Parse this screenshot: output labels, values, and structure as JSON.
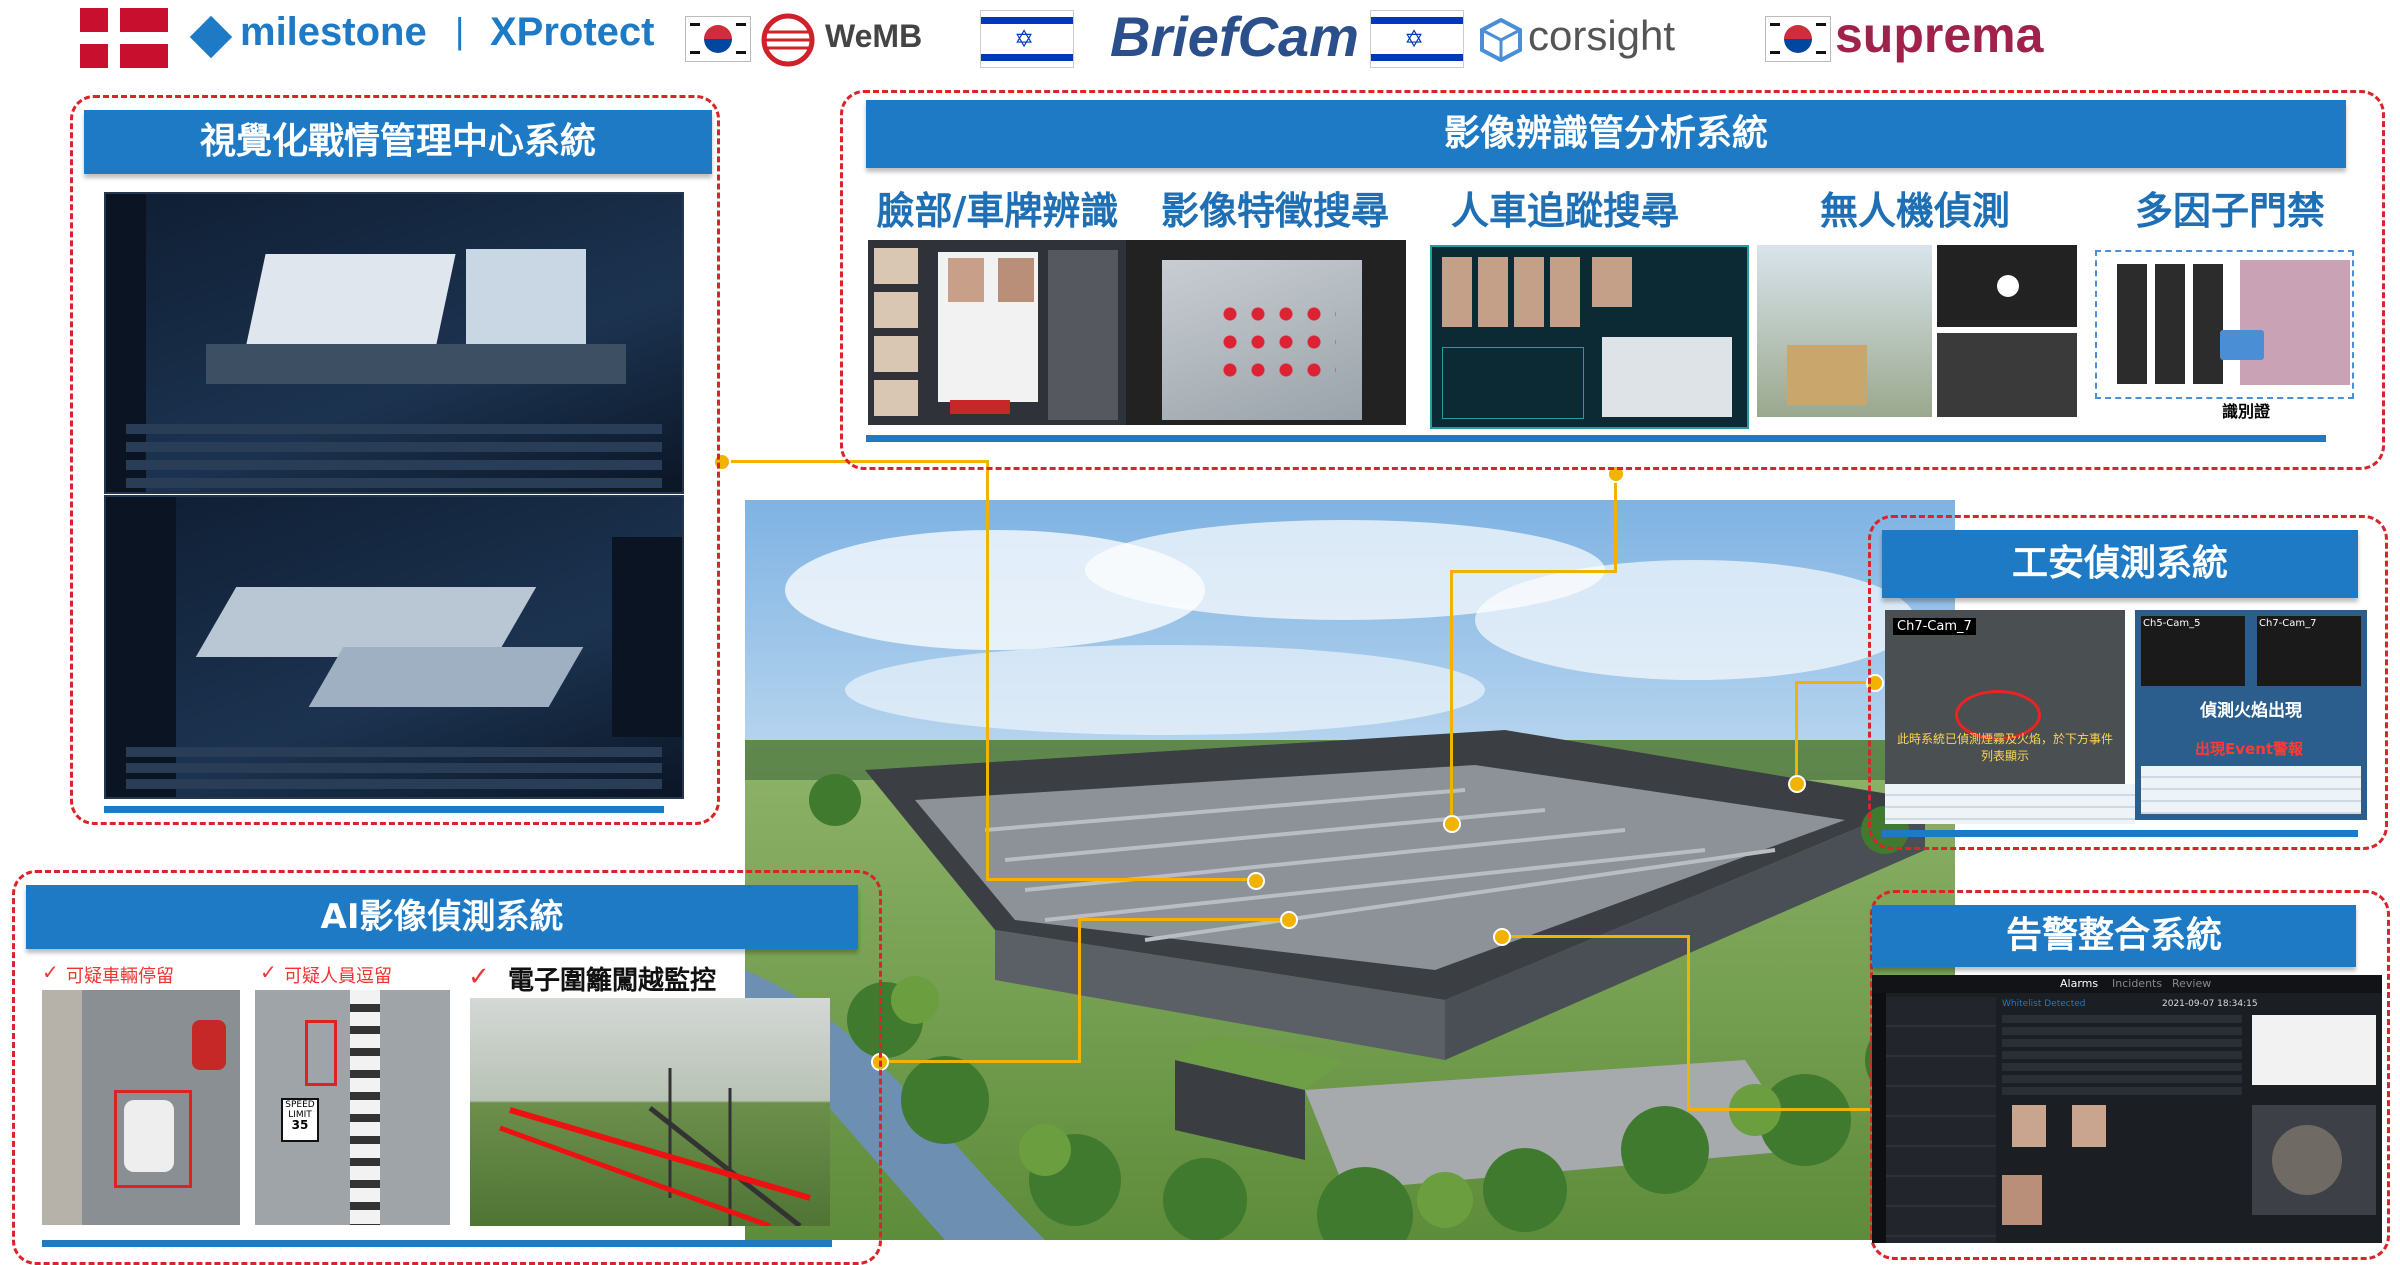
{
  "logos": {
    "milestone": "milestone",
    "separator": "|",
    "xprotect": "XProtect",
    "wemb": "WeMB",
    "briefcam": "BriefCam",
    "corsight": "corsight",
    "suprema": "suprema"
  },
  "panels": {
    "visual_command": {
      "title": "視覺化戰情管理中心系統"
    },
    "video_analysis": {
      "title": "影像辨識管分析系統",
      "features": [
        "臉部/車牌辨識",
        "影像特徵搜尋",
        "人車追蹤搜尋",
        "無人機偵測",
        "多因子門禁"
      ],
      "id_card_caption": "識別證"
    },
    "industrial_safety": {
      "title": "工安偵測系統",
      "cam_labels": [
        "Ch7-Cam_7",
        "Ch5-Cam_5",
        "Ch7-Cam_7"
      ],
      "overlay_text": "此時系統已偵測煙霧及火焰，於下方事件列表顯示",
      "fire_detected": "偵測火焰出現",
      "event_alarm": "出現Event警報"
    },
    "ai_detection": {
      "title": "AI影像偵測系統",
      "items": [
        "可疑車輛停留",
        "可疑人員逗留",
        "電子圍籬闖越監控"
      ],
      "speed_sign": [
        "SPEED",
        "LIMIT",
        "35"
      ]
    },
    "alarm_integration": {
      "title": "告警整合系統",
      "tabs": [
        "Alarms",
        "Incidents",
        "Review"
      ],
      "timestamp": "2021-09-07 18:34:15",
      "alarm_head": "Whitelist Detected"
    }
  },
  "colors": {
    "accent_blue": "#1f7ac6",
    "dashed_red": "#d9252a",
    "connector_yellow": "#f2b200",
    "suprema_red": "#a0224a"
  }
}
